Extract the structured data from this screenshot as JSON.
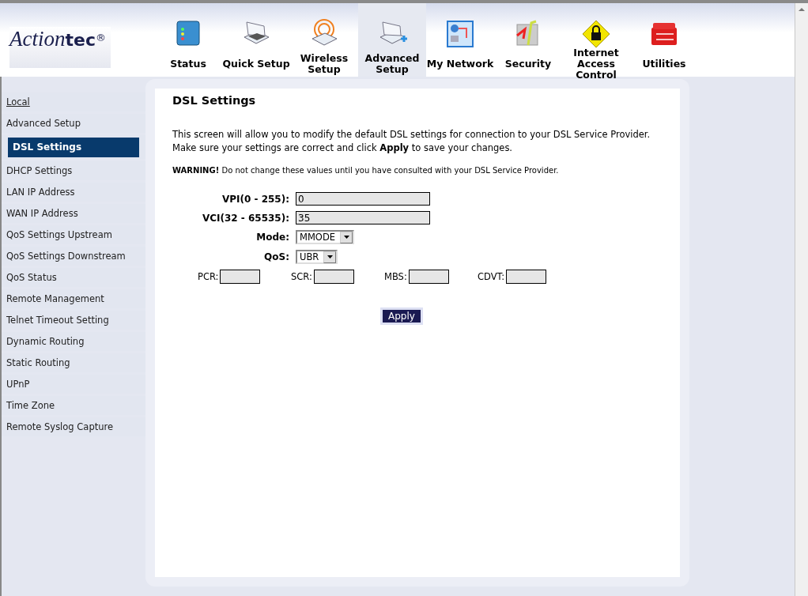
{
  "logo": {
    "word_start": "Action",
    "word_end": "tec",
    "mark": "®"
  },
  "nav": [
    {
      "kind": "status",
      "label": "Status",
      "selected": false
    },
    {
      "kind": "quick",
      "label": "Quick Setup",
      "selected": false
    },
    {
      "kind": "wireless",
      "label": "Wireless Setup",
      "selected": false
    },
    {
      "kind": "advanced",
      "label": "Advanced Setup",
      "selected": true
    },
    {
      "kind": "network",
      "label": "My Network",
      "selected": false
    },
    {
      "kind": "security",
      "label": "Security",
      "selected": false
    },
    {
      "kind": "access",
      "label": "Internet Access Control",
      "selected": false
    },
    {
      "kind": "utilities",
      "label": "Utilities",
      "selected": false
    }
  ],
  "sidebar": {
    "items": [
      {
        "kind": "link",
        "label": "Local",
        "selected": false
      },
      {
        "kind": "item",
        "label": "Advanced Setup",
        "selected": false
      },
      {
        "kind": "item",
        "label": "DSL Settings",
        "selected": true
      },
      {
        "kind": "item",
        "label": "DHCP Settings",
        "selected": false
      },
      {
        "kind": "item",
        "label": "LAN IP Address",
        "selected": false
      },
      {
        "kind": "item",
        "label": "WAN IP Address",
        "selected": false
      },
      {
        "kind": "item",
        "label": "QoS Settings Upstream",
        "selected": false
      },
      {
        "kind": "item",
        "label": "QoS Settings Downstream",
        "selected": false
      },
      {
        "kind": "item",
        "label": "QoS Status",
        "selected": false
      },
      {
        "kind": "item",
        "label": "Remote Management",
        "selected": false
      },
      {
        "kind": "item",
        "label": "Telnet Timeout Setting",
        "selected": false
      },
      {
        "kind": "item",
        "label": "Dynamic Routing",
        "selected": false
      },
      {
        "kind": "item",
        "label": "Static Routing",
        "selected": false
      },
      {
        "kind": "item",
        "label": "UPnP",
        "selected": false
      },
      {
        "kind": "item",
        "label": "Time Zone",
        "selected": false
      },
      {
        "kind": "item",
        "label": "Remote Syslog Capture",
        "selected": false
      }
    ]
  },
  "content": {
    "title": "DSL Settings",
    "intro": "This screen will allow you to modify the default DSL settings for connection to your DSL Service Provider. Make sure your settings are correct and click **Apply** to save your changes.",
    "warning": "**WARNING!** Do not change these values until you have consulted with your DSL Service Provider.",
    "fields": [
      {
        "kind": "text",
        "label": "VPI(0 - 255):",
        "value": "0"
      },
      {
        "kind": "text",
        "label": "VCI(32 - 65535):",
        "value": "35"
      },
      {
        "kind": "select",
        "label": "Mode:",
        "value": "MMODE"
      },
      {
        "kind": "select",
        "label": "QoS:",
        "value": "UBR"
      }
    ],
    "small_fields": [
      {
        "label": "PCR:"
      },
      {
        "label": "SCR:"
      },
      {
        "label": "MBS:"
      },
      {
        "label": "CDVT:"
      }
    ],
    "apply_button": "Apply"
  }
}
